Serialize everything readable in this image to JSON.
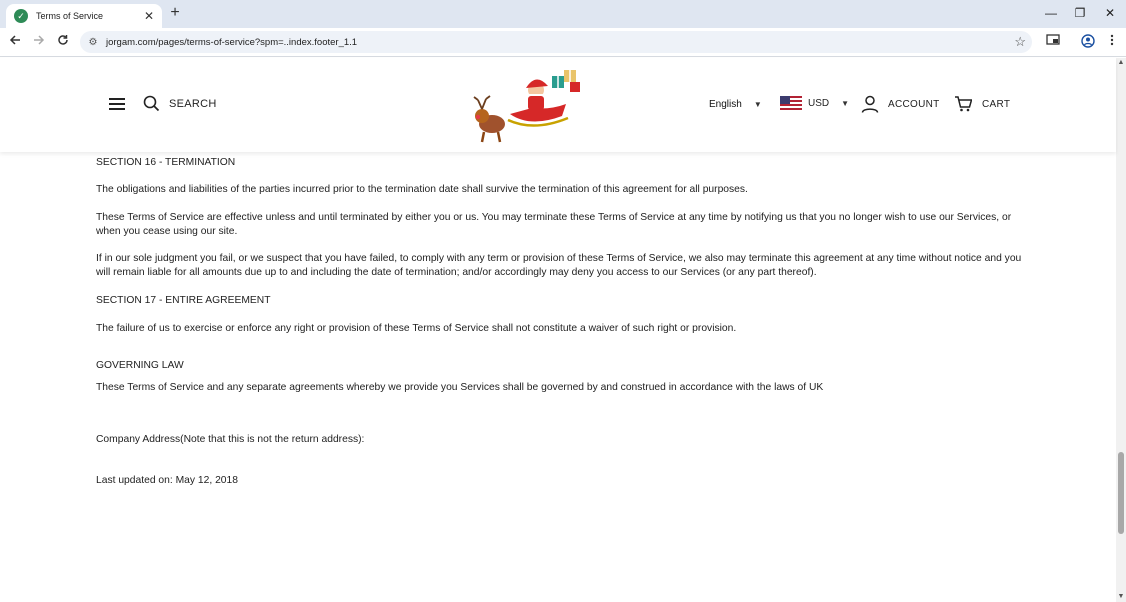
{
  "browser": {
    "tab_title": "Terms of Service",
    "tab_close": "✕",
    "new_tab": "+",
    "url": "jorgam.com/pages/terms-of-service?spm=..index.footer_1.1",
    "window_minimize": "—",
    "window_restore": "❐",
    "window_close": "✕"
  },
  "header": {
    "search_label": "SEARCH",
    "language": "English",
    "currency": "USD",
    "account_label": "ACCOUNT",
    "cart_label": "CART"
  },
  "content": {
    "section16_heading": "SECTION 16 - TERMINATION",
    "section16_p1": "The obligations and liabilities of the parties incurred prior to the termination date shall survive the termination of this agreement for all purposes.",
    "section16_p2": "These Terms of Service are effective unless and until terminated by either you or us. You may terminate these Terms of Service at any time by notifying us that you no longer wish to use our Services, or when you cease using our site.",
    "section16_p3": "If in our sole judgment you fail, or we suspect that you have failed, to comply with any term or provision of these Terms of Service, we also may terminate this agreement at any time without notice and you will remain liable for all amounts due up to and including the date of termination; and/or accordingly may deny you access to our Services (or any part thereof).",
    "section17_heading": "SECTION 17 - ENTIRE AGREEMENT",
    "section17_p1": "The failure of us to exercise or enforce any right or provision of these Terms of Service shall not constitute a waiver of such right or provision.",
    "governing_heading": "GOVERNING LAW",
    "governing_p1": "These Terms of Service and any separate agreements whereby we provide you Services shall be governed by and construed in accordance with the laws of UK",
    "company_address": "Company Address(Note that this is not the return address):",
    "last_updated": "Last updated on: May 12, 2018"
  },
  "colors": {
    "tabbar_bg": "#dfe6f1",
    "omnibox_bg": "#eef2f8",
    "text": "#222222"
  }
}
